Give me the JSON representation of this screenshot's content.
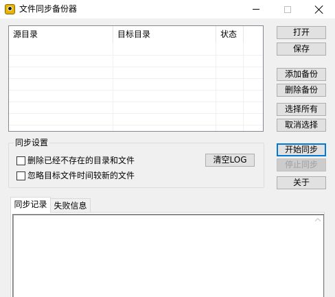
{
  "window": {
    "title": "文件同步备份器",
    "icon": "app-icon",
    "controls": [
      "minimize-icon",
      "maximize-icon",
      "close-icon"
    ]
  },
  "list": {
    "columns": [
      "源目录",
      "目标目录",
      "状态"
    ],
    "rows": []
  },
  "buttons": {
    "open": "打开",
    "save": "保存",
    "add_backup": "添加备份",
    "delete_backup": "删除备份",
    "select_all": "选择所有",
    "deselect": "取消选择",
    "start_sync": "开始同步",
    "stop_sync": "停止同步",
    "about": "关于",
    "clear_log": "清空LOG"
  },
  "sync_settings": {
    "title": "同步设置",
    "options": [
      {
        "label": "删除已经不存在的目录和文件",
        "checked": false
      },
      {
        "label": "忽略目标文件时间较新的文件",
        "checked": false
      }
    ]
  },
  "tabs": [
    {
      "label": "同步记录",
      "active": true
    },
    {
      "label": "失败信息",
      "active": false
    }
  ],
  "log": {
    "content": ""
  }
}
